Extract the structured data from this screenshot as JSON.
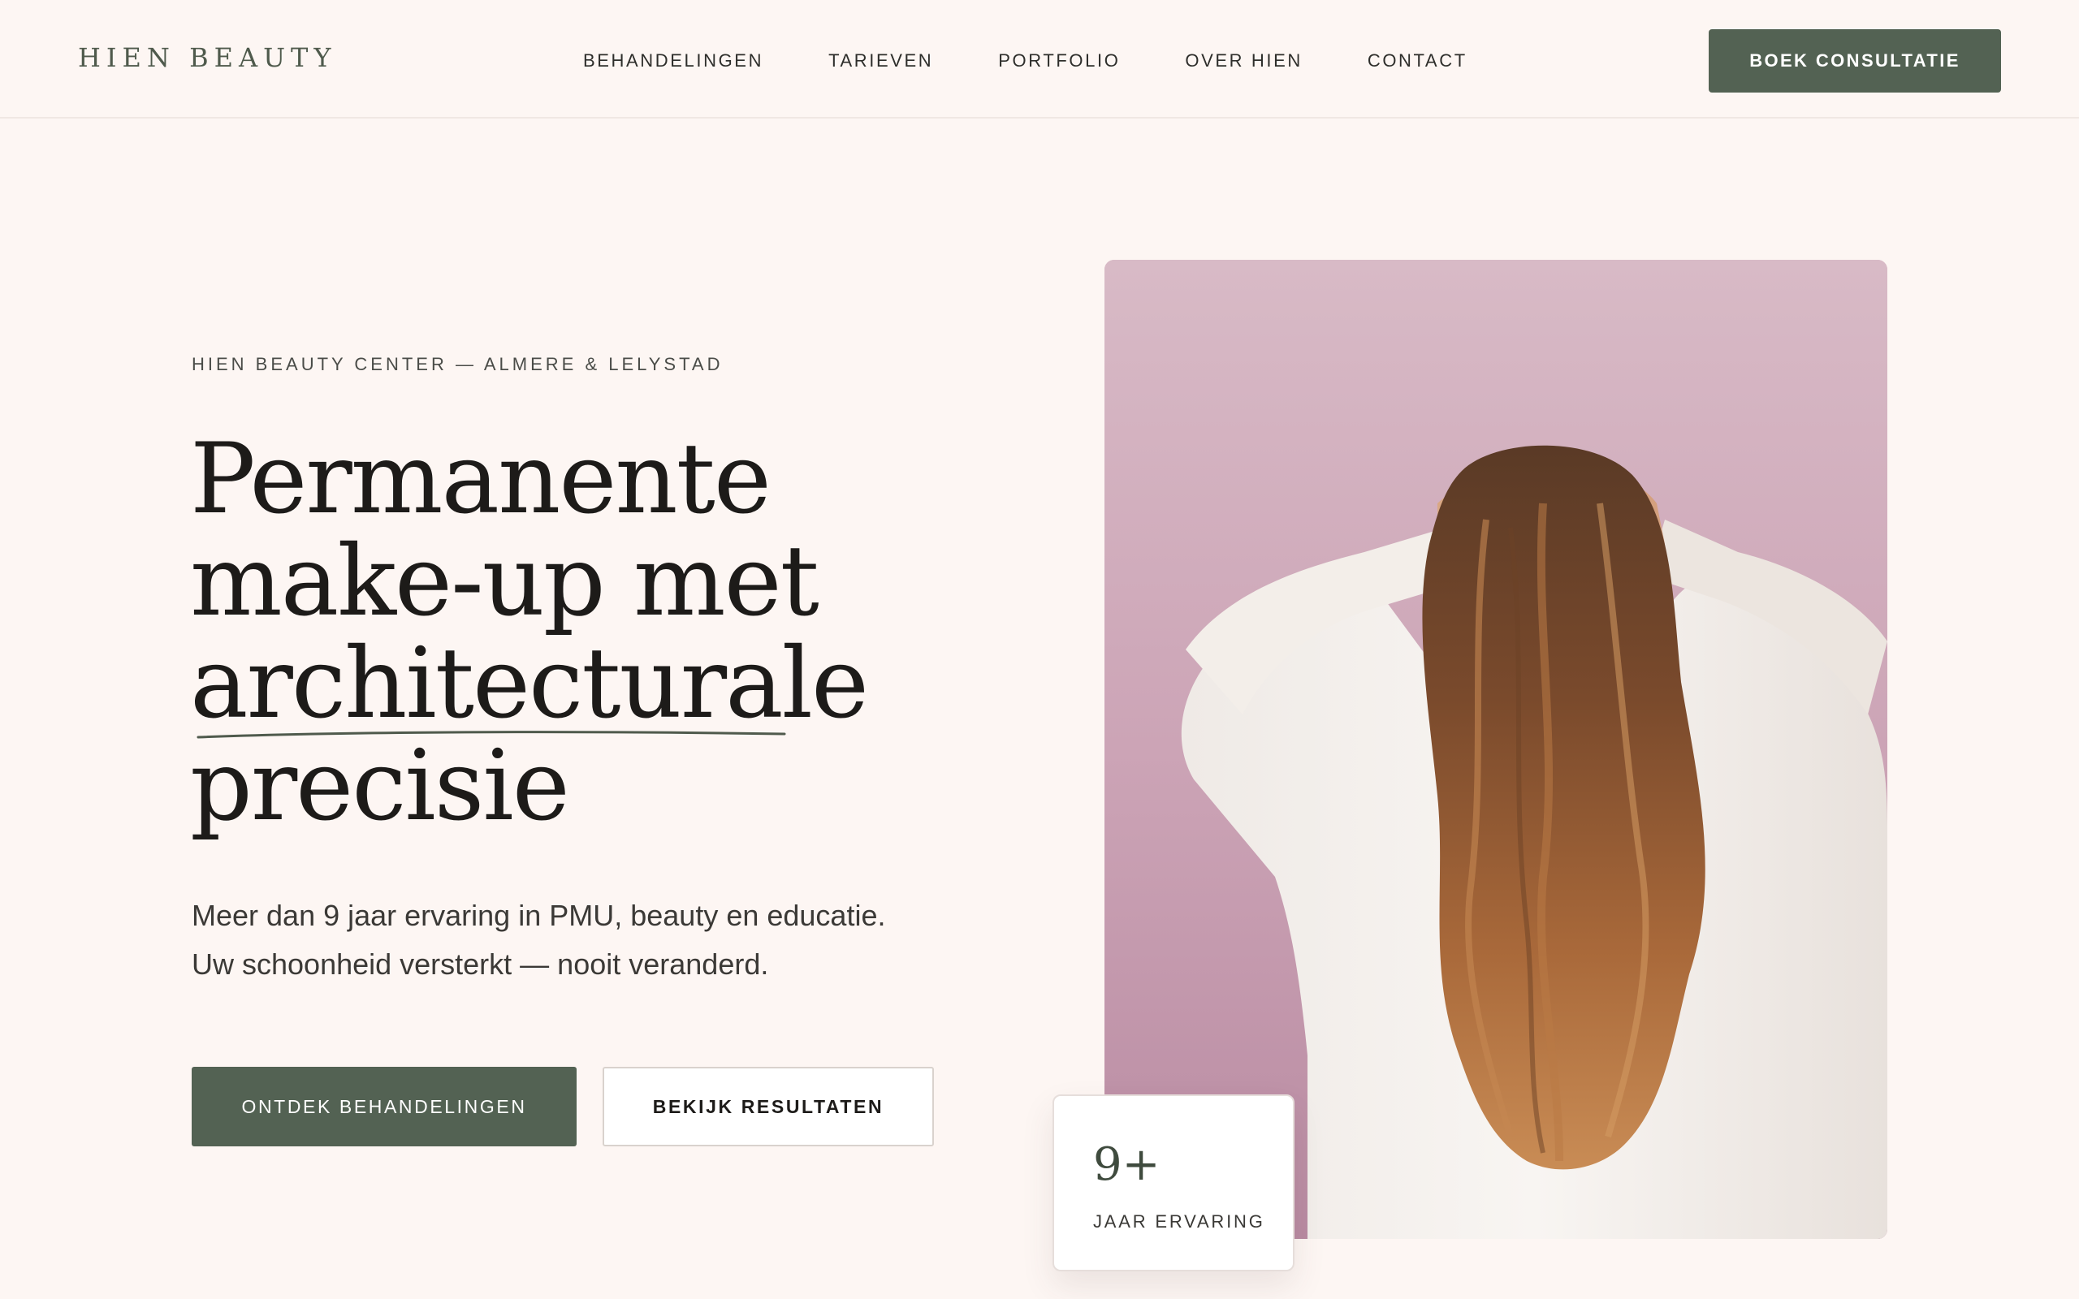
{
  "header": {
    "logo": "HIEN BEAUTY",
    "nav": [
      {
        "label": "BEHANDELINGEN"
      },
      {
        "label": "TARIEVEN"
      },
      {
        "label": "PORTFOLIO"
      },
      {
        "label": "OVER HIEN"
      },
      {
        "label": "CONTACT"
      }
    ],
    "cta_label": "BOEK CONSULTATIE"
  },
  "hero": {
    "eyebrow": "HIEN BEAUTY CENTER — ALMERE & LELYSTAD",
    "headline_lines": [
      "Permanente",
      "make-up met",
      "architecturale",
      "precisie"
    ],
    "lede_lines": [
      "Meer dan 9 jaar ervaring in PMU, beauty en educatie.",
      "Uw schoonheid versterkt — nooit veranderd."
    ],
    "primary_button": "ONTDEK BEHANDELINGEN",
    "secondary_button": "BEKIJK RESULTATEN"
  },
  "stat": {
    "value": "9+",
    "label": "JAAR ERVARING"
  },
  "colors": {
    "background": "#fdf6f3",
    "accent_green": "#536253",
    "image_backdrop_pink": "#cba3b5"
  }
}
